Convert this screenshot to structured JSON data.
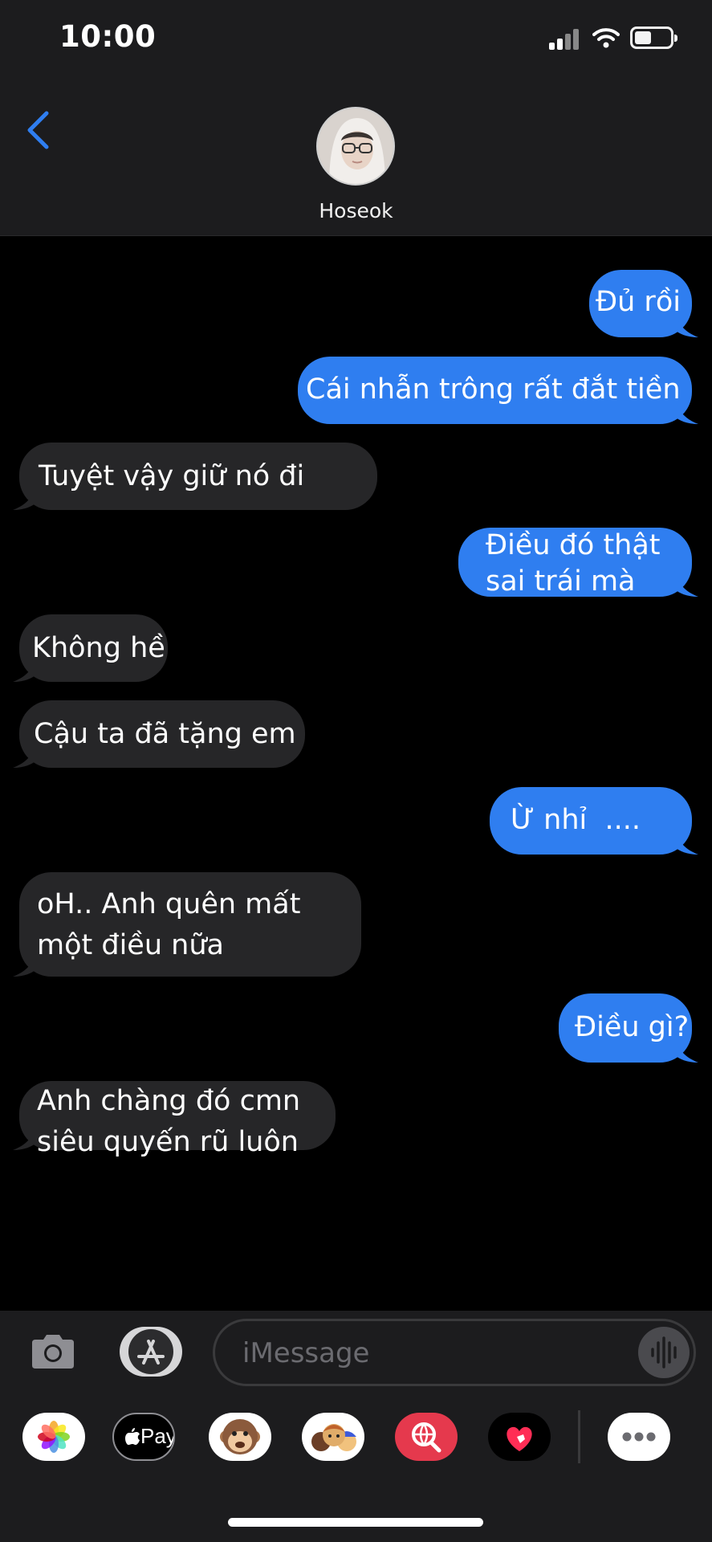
{
  "status_bar": {
    "time": "10:00"
  },
  "header": {
    "contact_name": "Hoseok",
    "back_icon": "chevron-left-icon",
    "accent": "#2f7ef0"
  },
  "messages": [
    {
      "direction": "outgoing",
      "text": "Đủ rồi"
    },
    {
      "direction": "outgoing",
      "text": "Cái nhẫn trông rất đắt tiền"
    },
    {
      "direction": "incoming",
      "text": "Tuyệt vậy giữ nó đi"
    },
    {
      "direction": "outgoing",
      "lines": [
        "Điều đó thật",
        "sai trái mà"
      ]
    },
    {
      "direction": "incoming",
      "text": "Không hề"
    },
    {
      "direction": "incoming",
      "text": "Cậu ta đã tặng em"
    },
    {
      "direction": "outgoing",
      "text": "Ừ nhỉ  ...."
    },
    {
      "direction": "incoming",
      "lines": [
        "oH.. Anh quên mất",
        "một điều nữa"
      ]
    },
    {
      "direction": "outgoing",
      "text": "Điều gì?"
    },
    {
      "direction": "incoming",
      "lines": [
        "Anh chàng đó cmn",
        "siêu quyến rũ luôn"
      ]
    }
  ],
  "composer": {
    "placeholder": "iMessage",
    "camera_icon": "camera-icon",
    "appstore_icon": "app-store-icon",
    "mic_icon": "audio-waveform-icon"
  },
  "app_drawer": [
    {
      "name": "photos-app-icon"
    },
    {
      "name": "apple-pay-app-icon",
      "label": "Pay"
    },
    {
      "name": "animoji-app-icon"
    },
    {
      "name": "memoji-app-icon"
    },
    {
      "name": "web-search-app-icon"
    },
    {
      "name": "digital-touch-app-icon"
    },
    {
      "name": "more-apps-icon"
    }
  ],
  "colors": {
    "outgoing_bubble": "#2f7ef0",
    "incoming_bubble": "#262628",
    "background": "#000000",
    "bar": "#1c1c1e"
  }
}
